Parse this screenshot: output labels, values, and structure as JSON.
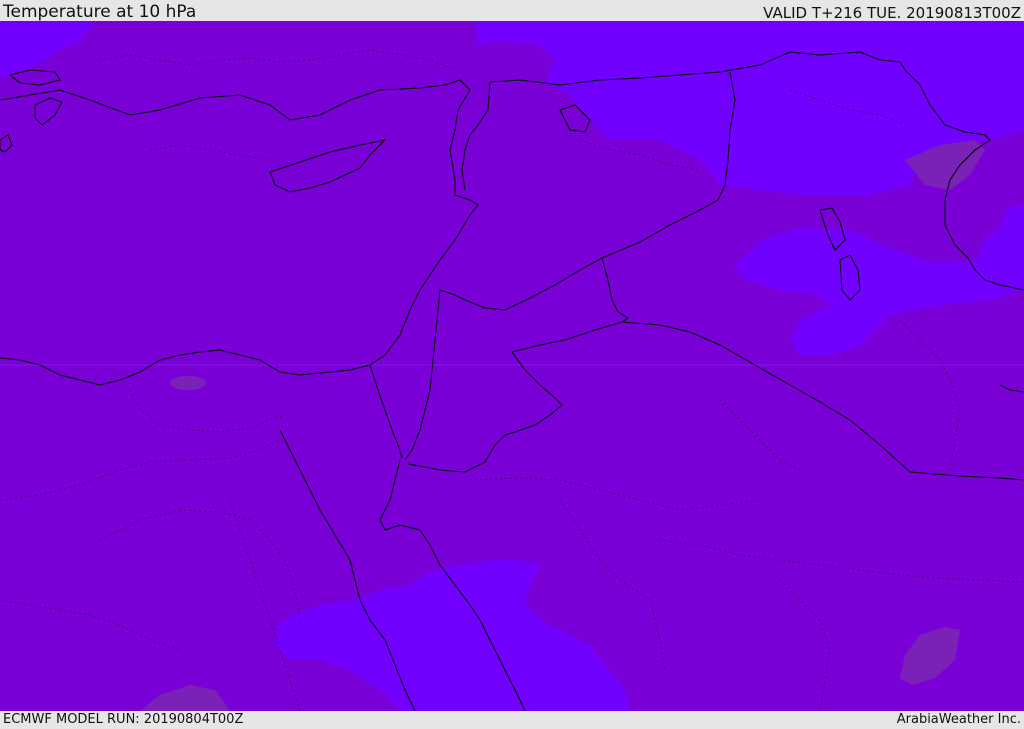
{
  "header": {
    "title": "Temperature at 10 hPa",
    "valid_time": "VALID T+216 TUE. 20190813T00Z"
  },
  "footer": {
    "model_run": "ECMWF MODEL RUN: 20190804T00Z",
    "credit": "ArabiaWeather Inc."
  },
  "map": {
    "colors": {
      "base_field": "#7a00d8",
      "warm_zone": "#7200ff",
      "cool_zone": "#7a22b8",
      "coastline": "#000000",
      "border": "#000000"
    }
  }
}
